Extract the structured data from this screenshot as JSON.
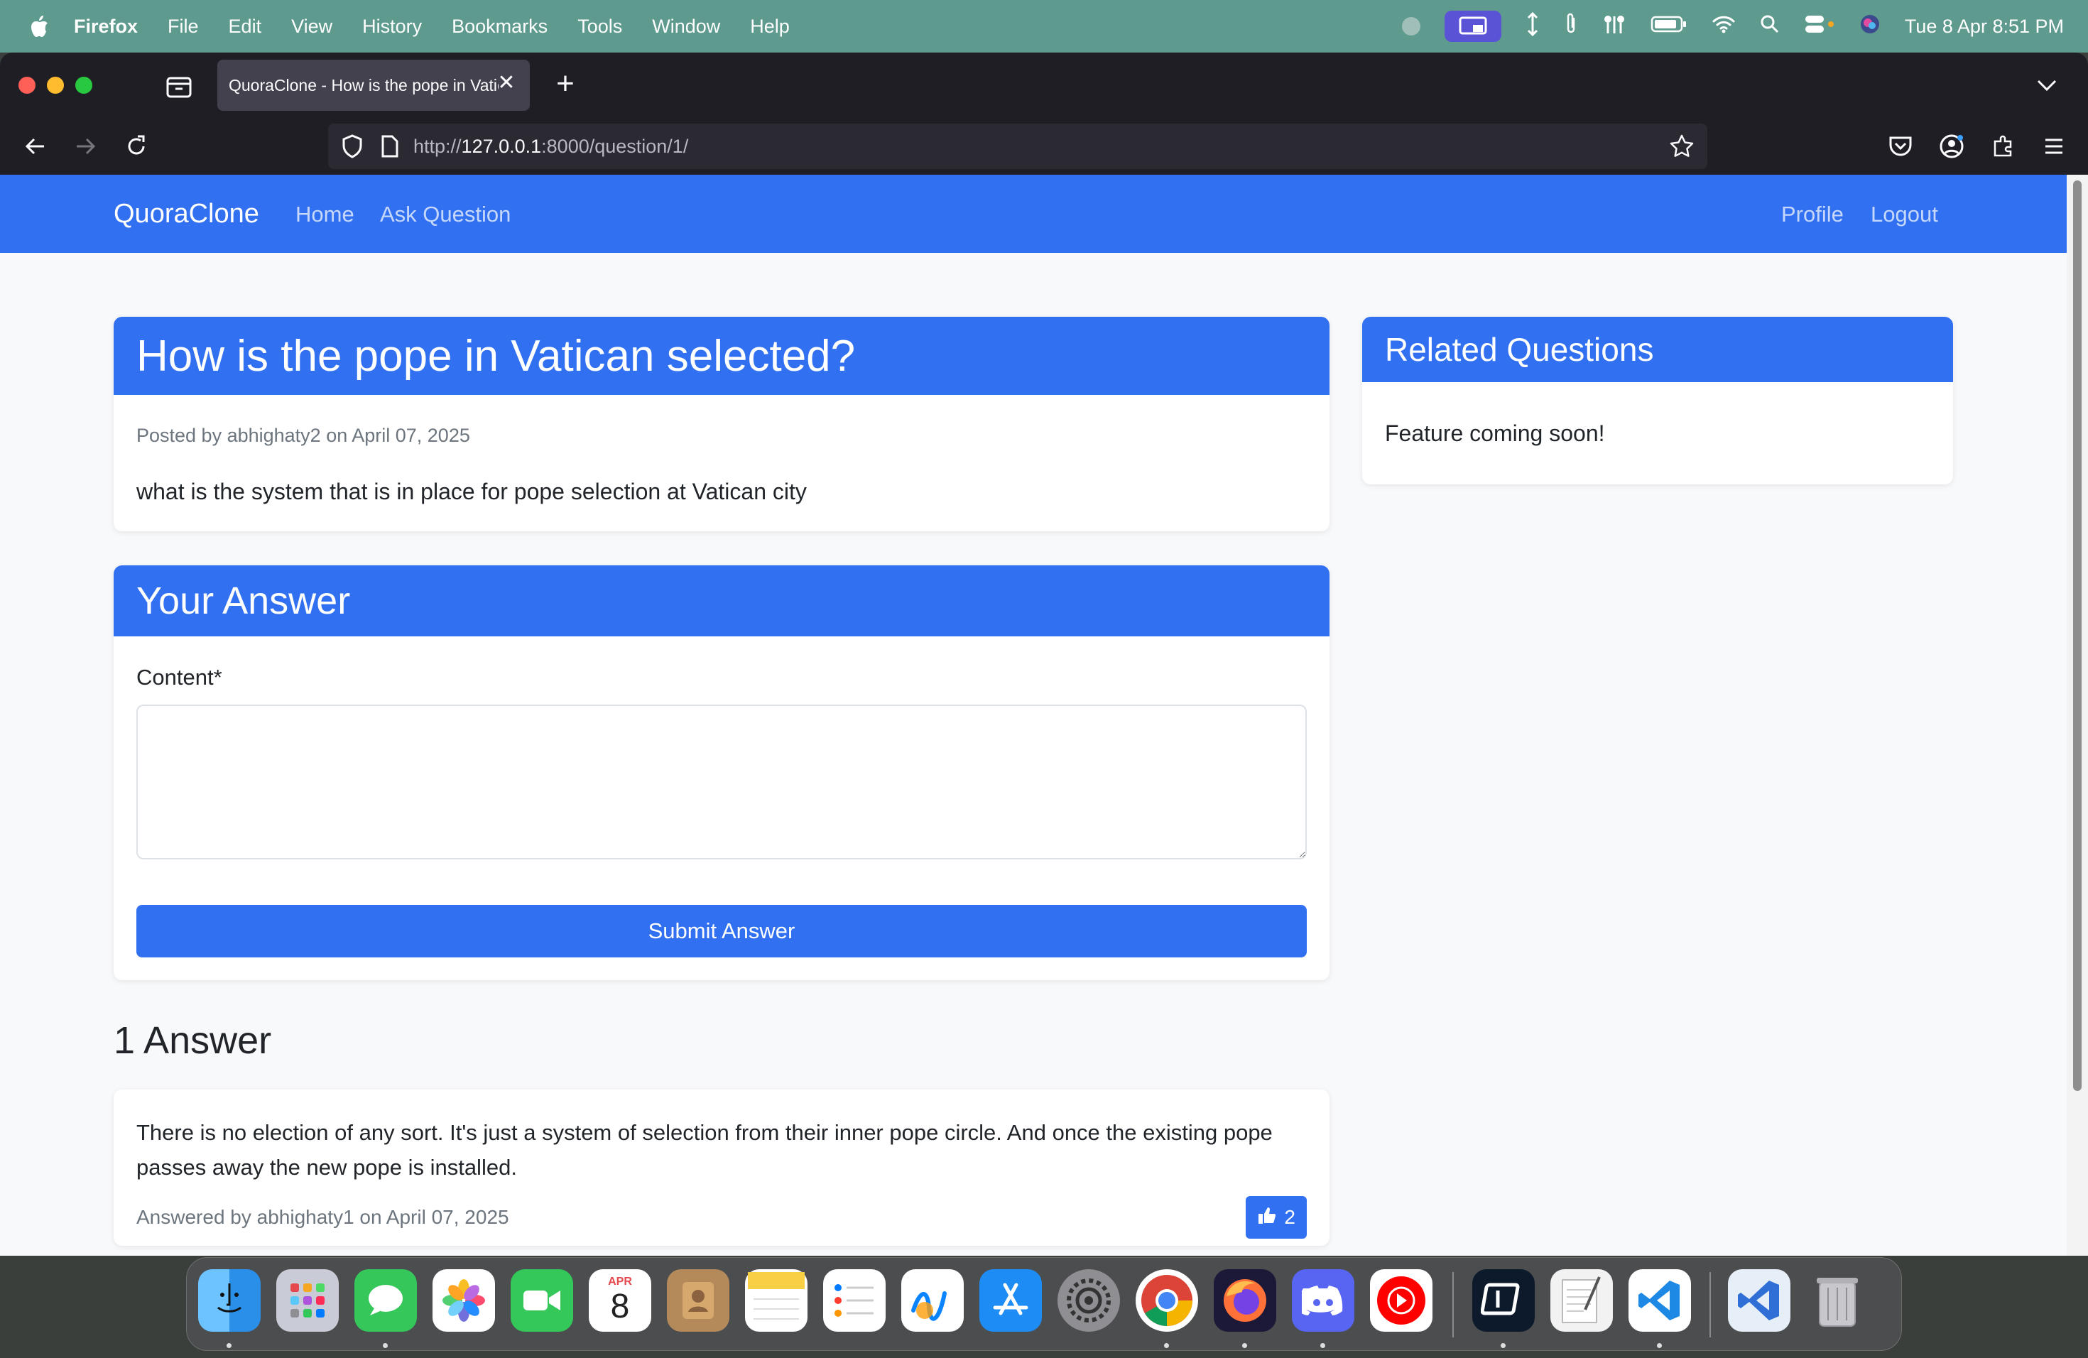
{
  "menubar": {
    "app_name": "Firefox",
    "items": [
      "File",
      "Edit",
      "View",
      "History",
      "Bookmarks",
      "Tools",
      "Window",
      "Help"
    ],
    "clock": "Tue 8 Apr  8:51 PM"
  },
  "browser": {
    "tab_title": "QuoraClone - How is the pope in Vatican selected?",
    "url_scheme": "http://",
    "url_host": "127.0.0.1",
    "url_rest": ":8000/question/1/"
  },
  "site_nav": {
    "brand": "QuoraClone",
    "home": "Home",
    "ask": "Ask Question",
    "profile": "Profile",
    "logout": "Logout"
  },
  "question": {
    "title": "How is the pope in Vatican selected?",
    "meta": "Posted by abhighaty2 on April 07, 2025",
    "body": "what is the system that is in place for pope selection at Vatican city"
  },
  "answer_form": {
    "heading": "Your Answer",
    "content_label": "Content*",
    "content_value": "",
    "submit_label": "Submit Answer"
  },
  "answers": {
    "heading": "1 Answer",
    "items": [
      {
        "text": "There is no election of any sort. It's just a system of selection from their inner pope circle. And once the existing pope passes away the new pope is installed.",
        "meta": "Answered by abhighaty1 on April 07, 2025",
        "likes": "2"
      }
    ]
  },
  "related": {
    "heading": "Related Questions",
    "text": "Feature coming soon!"
  },
  "calendar_icon": {
    "month": "APR",
    "day": "8"
  },
  "colors": {
    "primary": "#3170f0",
    "menubar": "#5f9a8e",
    "browser_chrome": "#1f1e24"
  },
  "dock_icons": [
    "finder-icon",
    "launchpad-icon",
    "messages-icon",
    "photos-icon",
    "facetime-icon",
    "calendar-icon",
    "contacts-icon",
    "notes-icon",
    "reminders-icon",
    "freeform-icon",
    "app-store-icon",
    "system-settings-icon",
    "chrome-icon",
    "firefox-icon",
    "discord-icon",
    "youtube-music-icon",
    "android-studio-icon",
    "textedit-icon",
    "vscode-icon",
    "vscode-insiders-icon",
    "trash-icon"
  ]
}
